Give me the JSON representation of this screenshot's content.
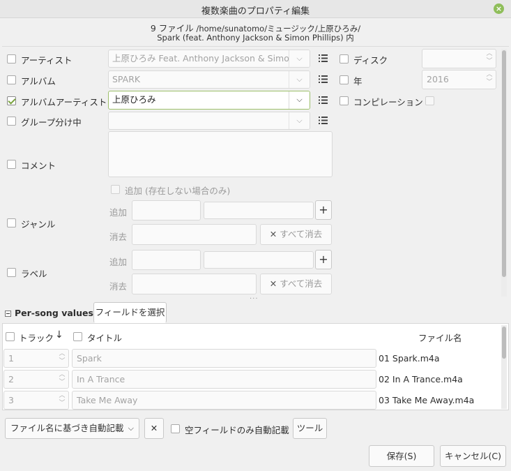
{
  "window": {
    "title": "複数楽曲のプロパティ編集"
  },
  "info": {
    "count": "9 ファイル",
    "path": "/home/sunatomo/ミュージック/上原ひろみ/",
    "album_path": "Spark (feat. Anthony Jackson & Simon Phillips)",
    "suffix": "内"
  },
  "fields": {
    "artist": {
      "label": "アーティスト",
      "value": "上原ひろみ Feat. Anthony Jackson & Simon"
    },
    "album": {
      "label": "アルバム",
      "value": "SPARK"
    },
    "album_artist": {
      "label": "アルバムアーティスト",
      "value": "上原ひろみ"
    },
    "grouping": {
      "label": "グループ分け中",
      "value": ""
    },
    "comment": {
      "label": "コメント"
    },
    "disc": {
      "label": "ディスク",
      "value": ""
    },
    "year": {
      "label": "年",
      "value": "2016"
    },
    "compilation": {
      "label": "コンピレーション"
    },
    "genre": {
      "label": "ジャンル",
      "add_if_missing": "追加 (存在しない場合のみ)",
      "add_label": "追加",
      "remove_label": "消去",
      "clear_all": "すべて消去"
    },
    "labels": {
      "label": "ラベル",
      "add_label": "追加",
      "remove_label": "消去",
      "clear_all": "すべて消去"
    }
  },
  "per_song": {
    "title": "Per-song values",
    "choose_fields": "フィールドを選択",
    "headers": {
      "track": "トラック",
      "title": "タイトル",
      "filename": "ファイル名"
    },
    "rows": [
      {
        "track": "1",
        "title": "Spark",
        "filename": "01 Spark.m4a"
      },
      {
        "track": "2",
        "title": "In A Trance",
        "filename": "02 In A Trance.m4a"
      },
      {
        "track": "3",
        "title": "Take Me Away",
        "filename": "03 Take Me Away.m4a"
      }
    ]
  },
  "bottom": {
    "autofill": "ファイル名に基づき自動記載",
    "empty_only": "空フィールドのみ自動記載",
    "tools": "ツール",
    "save": "保存(S)",
    "cancel": "キャンセル(C)"
  },
  "icons": {
    "close": "close-icon",
    "list": "list-icon",
    "dropdown": "chevron-down-icon",
    "add": "plus-icon",
    "clear": "x-icon",
    "sort": "arrow-down-icon"
  },
  "colors": {
    "accent": "#8fbe5a",
    "check": "#7aa33f"
  }
}
